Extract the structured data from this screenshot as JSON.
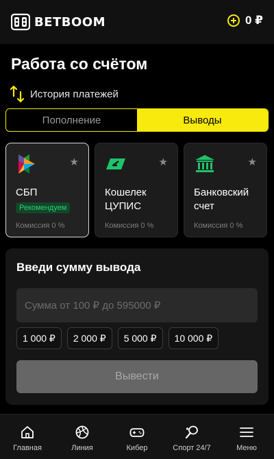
{
  "header": {
    "logo_text": "BETBOOM",
    "balance": "0 ₽",
    "balance_icon": "plus-circle-icon"
  },
  "page": {
    "title": "Работа со счётом",
    "history_label": "История платежей"
  },
  "tabs": [
    {
      "label": "Пополнение",
      "active": false
    },
    {
      "label": "Выводы",
      "active": true
    }
  ],
  "methods": [
    {
      "name": "СБП",
      "badge": "Рекомендуем",
      "commission": "Комиссия 0 %",
      "icon": "sbp-icon",
      "selected": true
    },
    {
      "name": "Кошелек ЦУПИС",
      "commission": "Комиссия 0 %",
      "icon": "wallet-icon",
      "selected": false
    },
    {
      "name": "Банковский счет",
      "commission": "Комиссия 0 %",
      "icon": "bank-icon",
      "selected": false
    }
  ],
  "amount": {
    "title": "Введи сумму вывода",
    "placeholder": "Сумма от 100 ₽ до 595000 ₽",
    "value": "",
    "quick_amounts": [
      "1 000 ₽",
      "2 000 ₽",
      "5 000 ₽",
      "10 000 ₽"
    ],
    "submit_label": "Вывести"
  },
  "nav": [
    {
      "label": "Главная",
      "icon": "home-icon"
    },
    {
      "label": "Линия",
      "icon": "ball-icon"
    },
    {
      "label": "Кибер",
      "icon": "gamepad-icon"
    },
    {
      "label": "Спорт 24/7",
      "icon": "racket-icon"
    },
    {
      "label": "Меню",
      "icon": "menu-icon"
    }
  ],
  "colors": {
    "accent": "#f7ea0c",
    "background": "#000000",
    "card": "#1c1c1c",
    "badge_text": "#27d36f",
    "wallet_green": "#1fc36b"
  }
}
